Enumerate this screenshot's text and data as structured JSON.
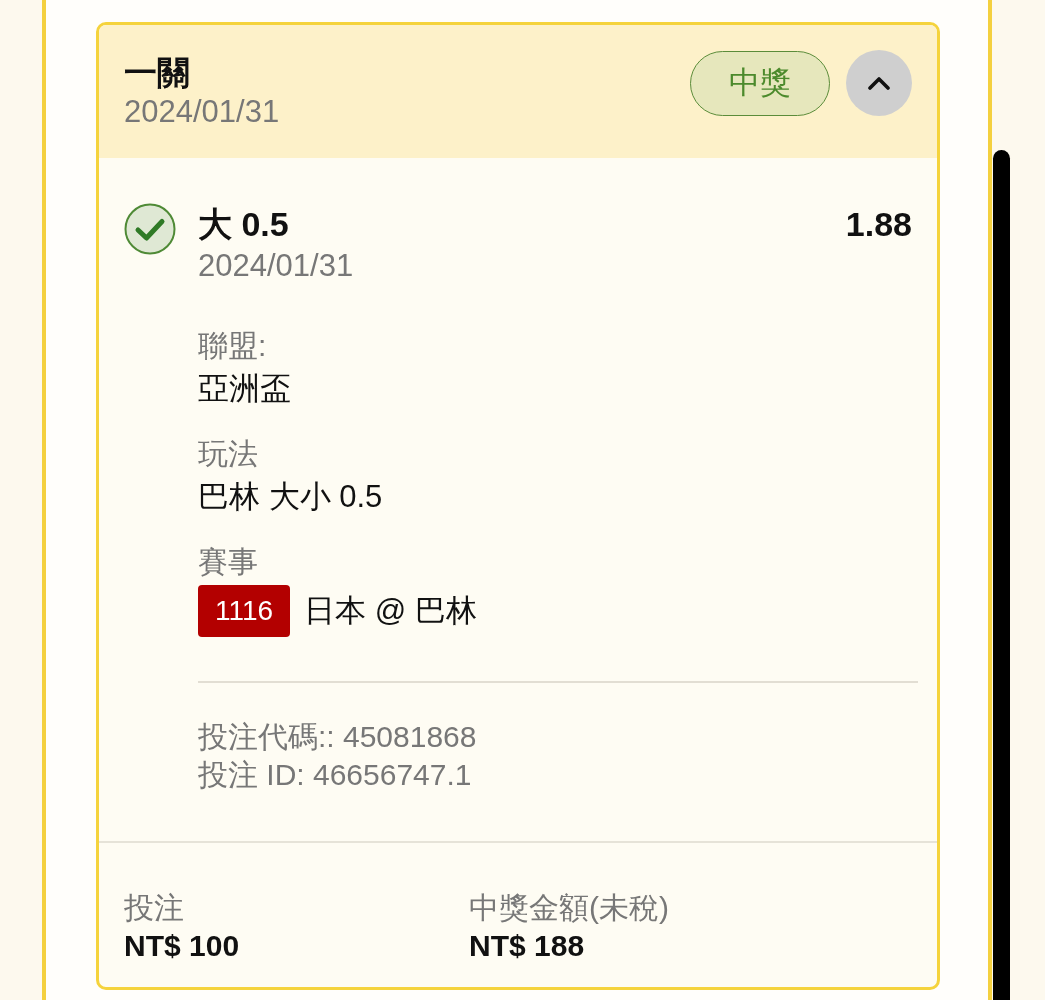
{
  "ticket": {
    "title": "一關",
    "date": "2024/01/31",
    "status_badge": "中獎",
    "expanded": true
  },
  "selection": {
    "won": true,
    "pick": "大 0.5",
    "odds": "1.88",
    "date": "2024/01/31"
  },
  "fields": [
    {
      "kind": "text",
      "label": "聯盟:",
      "value": "亞洲盃"
    },
    {
      "kind": "text",
      "label": "玩法",
      "value": "巴林 大小 0.5"
    },
    {
      "kind": "match",
      "label": "賽事",
      "code": "1116",
      "value": "日本 @ 巴林"
    }
  ],
  "bet_info": [
    "投注代碼:: 45081868",
    "投注 ID: 46656747.1"
  ],
  "summary": [
    {
      "label": "投注",
      "value": "NT$ 100"
    },
    {
      "label": "中獎金額(未稅)",
      "value": "NT$ 188"
    }
  ]
}
